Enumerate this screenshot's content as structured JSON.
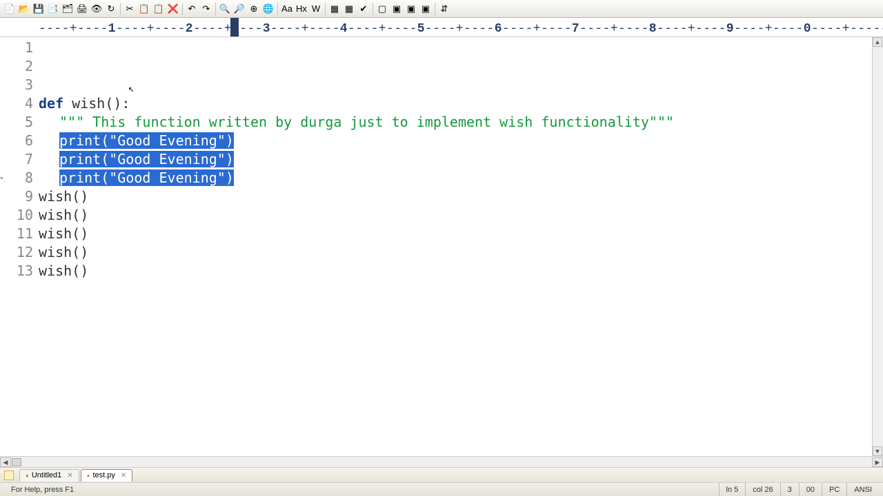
{
  "toolbar_icons": [
    "📄",
    "📂",
    "💾",
    "📑",
    "🗂",
    "🖨",
    "👁",
    "↻",
    " ",
    "✂",
    "📋",
    "📋",
    "❌",
    " ",
    "↶",
    "↷",
    " ",
    "🔍",
    "🔎",
    "⊕",
    "🌐",
    " ",
    "Aa",
    "Hx",
    "W",
    " ",
    "▦",
    "▦",
    "✔",
    " ",
    "▢",
    "▣",
    "▣",
    "▣",
    " ",
    "⇵"
  ],
  "ruler": {
    "majors": [
      "1",
      "2",
      "3",
      "4",
      "5",
      "6",
      "7",
      "8",
      "9",
      "0"
    ],
    "cursor_col": 26
  },
  "code": {
    "lines": [
      {
        "n": 1,
        "segments": [
          {
            "t": "def ",
            "c": "kw"
          },
          {
            "t": "wish():",
            "c": "plain"
          }
        ],
        "fold": true
      },
      {
        "n": 2,
        "indent": 1,
        "segments": [
          {
            "t": "\"\"\" This function written by durga just to implement wish functionality\"\"\"",
            "c": "str"
          }
        ]
      },
      {
        "n": 3,
        "indent": 1,
        "sel": true,
        "segments": [
          {
            "t": "print(",
            "c": "fn"
          },
          {
            "t": "\"Good Evening\"",
            "c": "str"
          },
          {
            "t": ")",
            "c": "fn"
          }
        ]
      },
      {
        "n": 4,
        "indent": 1,
        "sel": true,
        "segments": [
          {
            "t": "print(",
            "c": "fn"
          },
          {
            "t": "\"Good Evening\"",
            "c": "str"
          },
          {
            "t": ")",
            "c": "fn"
          }
        ]
      },
      {
        "n": 5,
        "indent": 1,
        "sel": true,
        "arrow": true,
        "segments": [
          {
            "t": "print(",
            "c": "fn"
          },
          {
            "t": "\"Good Evening\"",
            "c": "str"
          },
          {
            "t": ")",
            "c": "fn"
          }
        ]
      },
      {
        "n": 6,
        "segments": [
          {
            "t": "wish()",
            "c": "plain"
          }
        ]
      },
      {
        "n": 7,
        "segments": [
          {
            "t": "wish()",
            "c": "plain"
          }
        ]
      },
      {
        "n": 8,
        "segments": [
          {
            "t": "wish()",
            "c": "plain"
          }
        ]
      },
      {
        "n": 9,
        "segments": [
          {
            "t": "wish()",
            "c": "plain"
          }
        ]
      },
      {
        "n": 10,
        "segments": [
          {
            "t": "wish()",
            "c": "plain"
          }
        ]
      },
      {
        "n": 11,
        "segments": []
      },
      {
        "n": 12,
        "segments": []
      },
      {
        "n": 13,
        "segments": []
      }
    ]
  },
  "tabs": [
    {
      "label": "Untitled1",
      "active": false
    },
    {
      "label": "test.py",
      "active": true
    }
  ],
  "status": {
    "help": "For Help, press F1",
    "ln": "ln 5",
    "col": "col 26",
    "sel": "3",
    "mode": "00",
    "enc": "PC",
    "charset": "ANSI"
  }
}
